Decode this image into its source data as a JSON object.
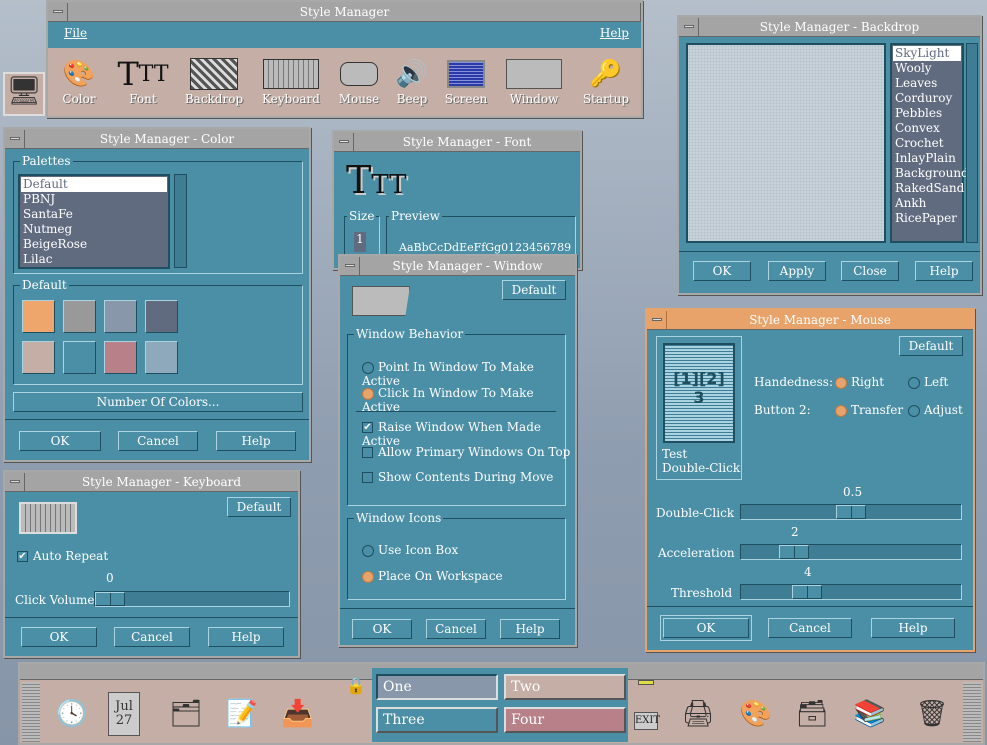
{
  "colors": {
    "teal": "#4a8fa6",
    "titlebar": "#a4a4a4",
    "active_titlebar": "#e8a36a",
    "beige": "#c4aea6",
    "list_bg": "#616b80"
  },
  "main": {
    "title": "Style Manager",
    "menu": {
      "file": "File",
      "help": "Help"
    },
    "icons": [
      {
        "label": "Color",
        "icon": "palette-icon"
      },
      {
        "label": "Font",
        "icon": "font-icon"
      },
      {
        "label": "Backdrop",
        "icon": "backdrop-icon"
      },
      {
        "label": "Keyboard",
        "icon": "keyboard-icon"
      },
      {
        "label": "Mouse",
        "icon": "mouse-icon"
      },
      {
        "label": "Beep",
        "icon": "speaker-icon"
      },
      {
        "label": "Screen",
        "icon": "screen-icon"
      },
      {
        "label": "Window",
        "icon": "window-icon"
      },
      {
        "label": "Startup",
        "icon": "key-icon"
      }
    ]
  },
  "color": {
    "title": "Style Manager - Color",
    "palettes_label": "Palettes",
    "palettes": [
      "Default",
      "PBNJ",
      "SantaFe",
      "Nutmeg",
      "BeigeRose",
      "Lilac"
    ],
    "selected": "Default",
    "group_label": "Default",
    "swatches": [
      "#eea66c",
      "#999999",
      "#8898aa",
      "#616b80",
      "#c4aea6",
      "#4a8fa6",
      "#b88088",
      "#8ea8bc"
    ],
    "num_colors": "Number Of Colors...",
    "ok": "OK",
    "cancel": "Cancel",
    "help": "Help"
  },
  "font": {
    "title": "Style Manager - Font",
    "size_label": "Size",
    "size_value": "1",
    "preview_label": "Preview",
    "preview_text": "AaBbCcDdEeFfGg0123456789"
  },
  "window": {
    "title": "Style Manager - Window",
    "default": "Default",
    "behavior_label": "Window Behavior",
    "point": "Point In Window To Make Active",
    "click": "Click In Window To Make Active",
    "raise": "Raise Window When Made Active",
    "primary": "Allow Primary Windows On Top",
    "contents": "Show Contents During Move",
    "icons_label": "Window Icons",
    "iconbox": "Use Icon Box",
    "workspace": "Place On Workspace",
    "ok": "OK",
    "cancel": "Cancel",
    "help": "Help"
  },
  "keyboard": {
    "title": "Style Manager - Keyboard",
    "default": "Default",
    "auto_repeat": "Auto Repeat",
    "volume_value": "0",
    "volume_label": "Click Volume",
    "ok": "OK",
    "cancel": "Cancel",
    "help": "Help"
  },
  "backdrop": {
    "title": "Style Manager - Backdrop",
    "items": [
      "SkyLight",
      "Wooly",
      "Leaves",
      "Corduroy",
      "Pebbles",
      "Convex",
      "Crochet",
      "InlayPlain",
      "Background",
      "RakedSand",
      "Ankh",
      "RicePaper"
    ],
    "selected": "SkyLight",
    "ok": "OK",
    "apply": "Apply",
    "close": "Close",
    "help": "Help"
  },
  "mouse": {
    "title": "Style Manager - Mouse",
    "default": "Default",
    "test1": "Test",
    "test2": "Double-Click",
    "handedness": "Handedness:",
    "right": "Right",
    "left": "Left",
    "button2": "Button 2:",
    "transfer": "Transfer",
    "adjust": "Adjust",
    "double_click_label": "Double-Click",
    "double_click_value": "0.5",
    "accel_label": "Acceleration",
    "accel_value": "2",
    "threshold_label": "Threshold",
    "threshold_value": "4",
    "ok": "OK",
    "cancel": "Cancel",
    "help": "Help"
  },
  "panel": {
    "calendar_month": "Jul",
    "calendar_day": "27",
    "workspaces": [
      {
        "label": "One",
        "color": "#8898aa"
      },
      {
        "label": "Two",
        "color": "#c4aea6"
      },
      {
        "label": "Three",
        "color": "#4a8fa6"
      },
      {
        "label": "Four",
        "color": "#b88088"
      }
    ],
    "exit": "EXIT"
  }
}
